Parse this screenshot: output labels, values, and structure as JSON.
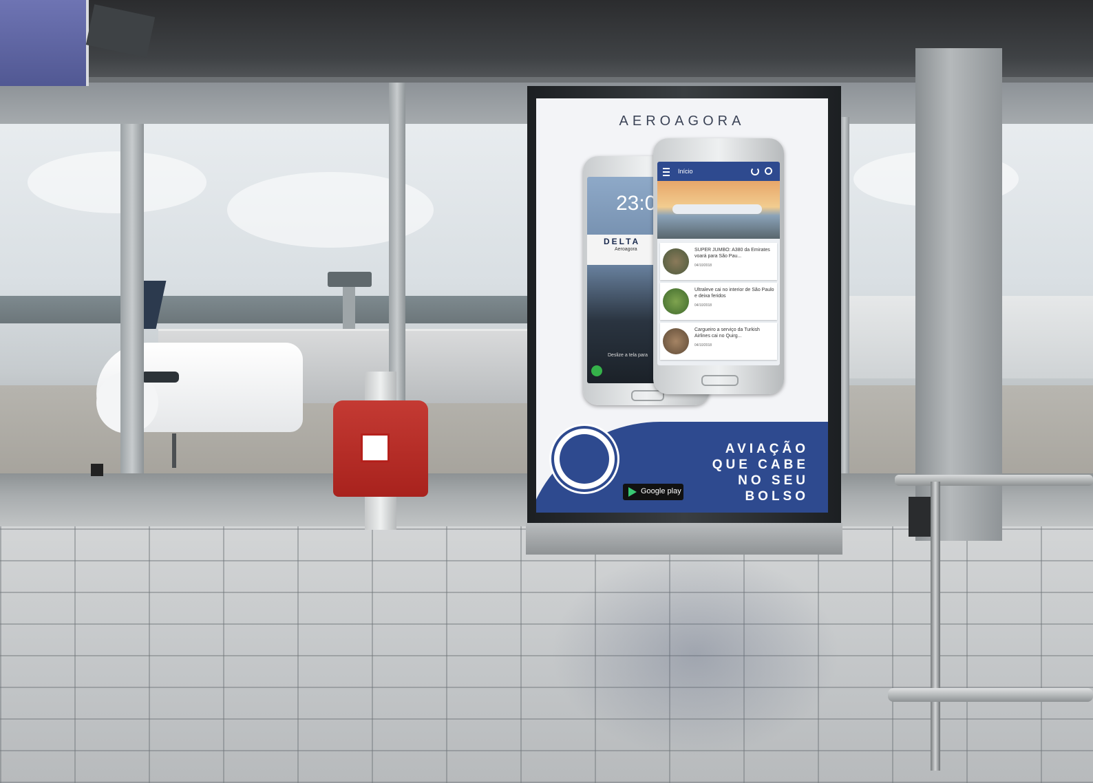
{
  "poster": {
    "brand": "AEROAGORA",
    "tagline": [
      "AVIAÇÃO",
      "QUE CABE",
      "NO SEU",
      "BOLSO"
    ],
    "store_badge": "Google play",
    "colors": {
      "brand_blue": "#2e4a8f",
      "poster_bg": "#f3f4f7"
    }
  },
  "phone_back": {
    "clock": "23:0",
    "card_brand": "DELTA",
    "card_app": "Aeroagora",
    "swipe_hint": "Deslize a tela para"
  },
  "phone_front": {
    "app_bar_title": "Início",
    "news": [
      {
        "title": "SUPER JUMBO: A380 da Emirates voará para São Pau...",
        "date": "04/10/2018"
      },
      {
        "title": "Ultraleve cai no interior de São Paulo e deixa feridos",
        "date": "04/10/2018"
      },
      {
        "title": "Cargueiro a serviço da Turkish Airlines cai no Quirg...",
        "date": "04/10/2018"
      }
    ]
  }
}
